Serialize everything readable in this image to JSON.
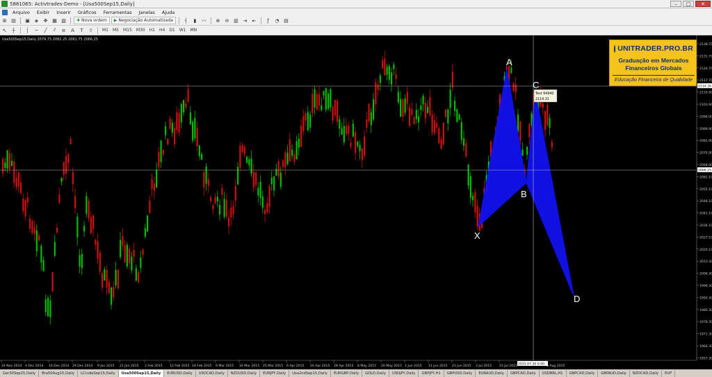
{
  "titlebar": {
    "title": "5881065: Activtrades-Demo - [Usa500Sep15,Daily]"
  },
  "menu": [
    "Arquivo",
    "Exibir",
    "Inserir",
    "Gráficos",
    "Ferramentas",
    "Janelas",
    "Ajuda"
  ],
  "toolbar": {
    "new_order": "Nova ordem",
    "auto_trading": "Negociação Automatizada",
    "timeframes": [
      "M1",
      "M5",
      "M15",
      "M30",
      "H1",
      "H4",
      "D1",
      "W1",
      "MN"
    ]
  },
  "chart": {
    "header": "Usa500Sep15,Daily  2079.75 2082.25 2061.75 2066.25",
    "current_price": "2066.25",
    "crosshair_price": "2114.30",
    "crosshair_date": "2015.07.30 0:00",
    "tooltip_line1": "Text 64940",
    "tooltip_line2": "2114.31",
    "bull_color": "#00c000",
    "bear_color": "#d01010",
    "pattern_color": "#1111ee"
  },
  "pattern_labels": [
    "X",
    "A",
    "B",
    "C",
    "D"
  ],
  "price_axis": [
    "2138.70",
    "2131.70",
    "2124.70",
    "2117.70",
    "2110.90",
    "2103.90",
    "2096.90",
    "2089.90",
    "2082.90",
    "2075.90",
    "2068.90",
    "2062.10",
    "2055.10",
    "2048.10",
    "2041.10",
    "2034.10",
    "2027.10",
    "2020.10",
    "2013.30",
    "2006.30",
    "1999.30",
    "1992.30",
    "1985.30",
    "1978.30",
    "1971.30",
    "1964.30",
    "1957.30"
  ],
  "date_axis": [
    "24 Nov 2014",
    "4 Dec 2014",
    "16 Dec 2014",
    "29 Dec 2014",
    "9 Jan 2015",
    "21 Jan 2015",
    "2 Feb 2015",
    "12 Feb 2015",
    "24 Feb 2015",
    "6 Mar 2015",
    "16 Mar 2015",
    "25 Mar 2015",
    "6 Apr 2015",
    "16 Apr 2015",
    "28 Apr 2015",
    "8 May 2015",
    "20 May 2015",
    "1 Jun 2015",
    "11 Jun 2015",
    "23 Jun 2015",
    "3 Jul 2015",
    "15 Jul 2015",
    "6 Aug 2015"
  ],
  "badge": {
    "brand": "UNITRADER.PRO.BR",
    "line1": "Graduação em Mercados",
    "line2": "Financeiros Globais",
    "tagline": "Educação Financeira de Qualidade"
  },
  "tabs": [
    "Ger30Sep15,Daily",
    "Bra50Aug15,Daily",
    "LCrudeSep15,Daily",
    "Usa500Sep15,Daily",
    "EURUSD,Daily",
    "USDCAD,Daily",
    "NZDUSD,Daily",
    "EURJPY,Daily",
    "Usa2ndSep15,Daily",
    "EURGBP,Daily",
    "GOLD,Daily",
    "USDJPY,Daily",
    "GBPJPY,H1",
    "GBPUSD,Daily",
    "EURAUD,Daily",
    "GBPCAD,Daily",
    "USDBRL,H1",
    "GBPCAD,Daily",
    "GBPAUD,Daily",
    "NZDCAD,Daily",
    "EUF"
  ],
  "active_tab": 3
}
